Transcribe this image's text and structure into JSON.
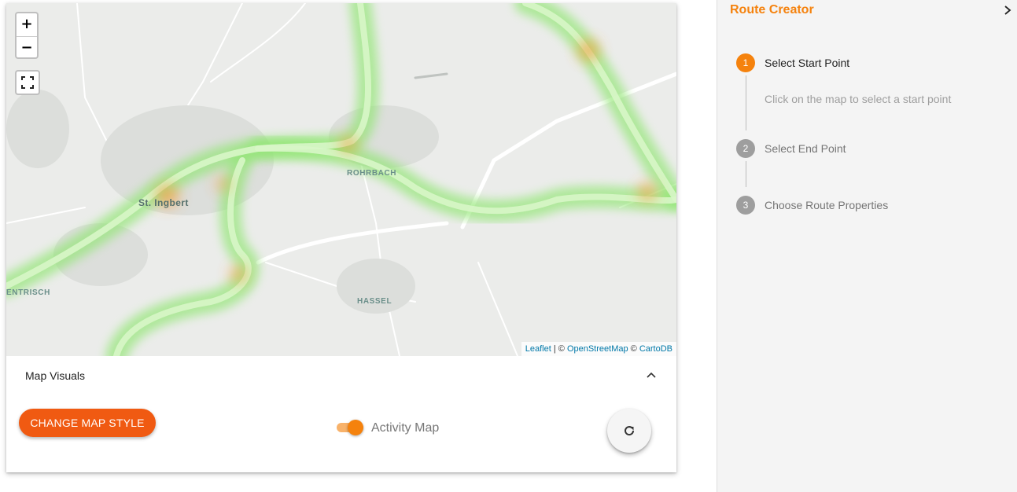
{
  "map": {
    "zoom_in": "+",
    "zoom_out": "−",
    "labels": {
      "st_ingbert": "St. Ingbert",
      "rohrbach": "ROHRBACH",
      "hassel": "HASSEL",
      "entrisch": "ENTRISCH"
    },
    "attribution": {
      "leaflet": "Leaflet",
      "sep": " | © ",
      "osm": "OpenStreetMap",
      "sep2": " © ",
      "carto": "CartoDB"
    },
    "colors": {
      "heat_low": "#7fe06a",
      "heat_high": "#f5a040",
      "background": "#ebecea"
    }
  },
  "visuals": {
    "title": "Map Visuals",
    "change_style": "Change map style",
    "activity_toggle_label": "Activity Map",
    "activity_enabled": true,
    "icons": {
      "collapse": "chevron-up-icon",
      "refresh": "refresh-icon"
    }
  },
  "sidebar": {
    "title": "Route Creator",
    "accent": "#f5820d",
    "steps": [
      {
        "number": "1",
        "label": "Select Start Point",
        "hint": "Click on the map to select a start point",
        "active": true
      },
      {
        "number": "2",
        "label": "Select End Point",
        "active": false
      },
      {
        "number": "3",
        "label": "Choose Route Properties",
        "active": false
      }
    ]
  }
}
